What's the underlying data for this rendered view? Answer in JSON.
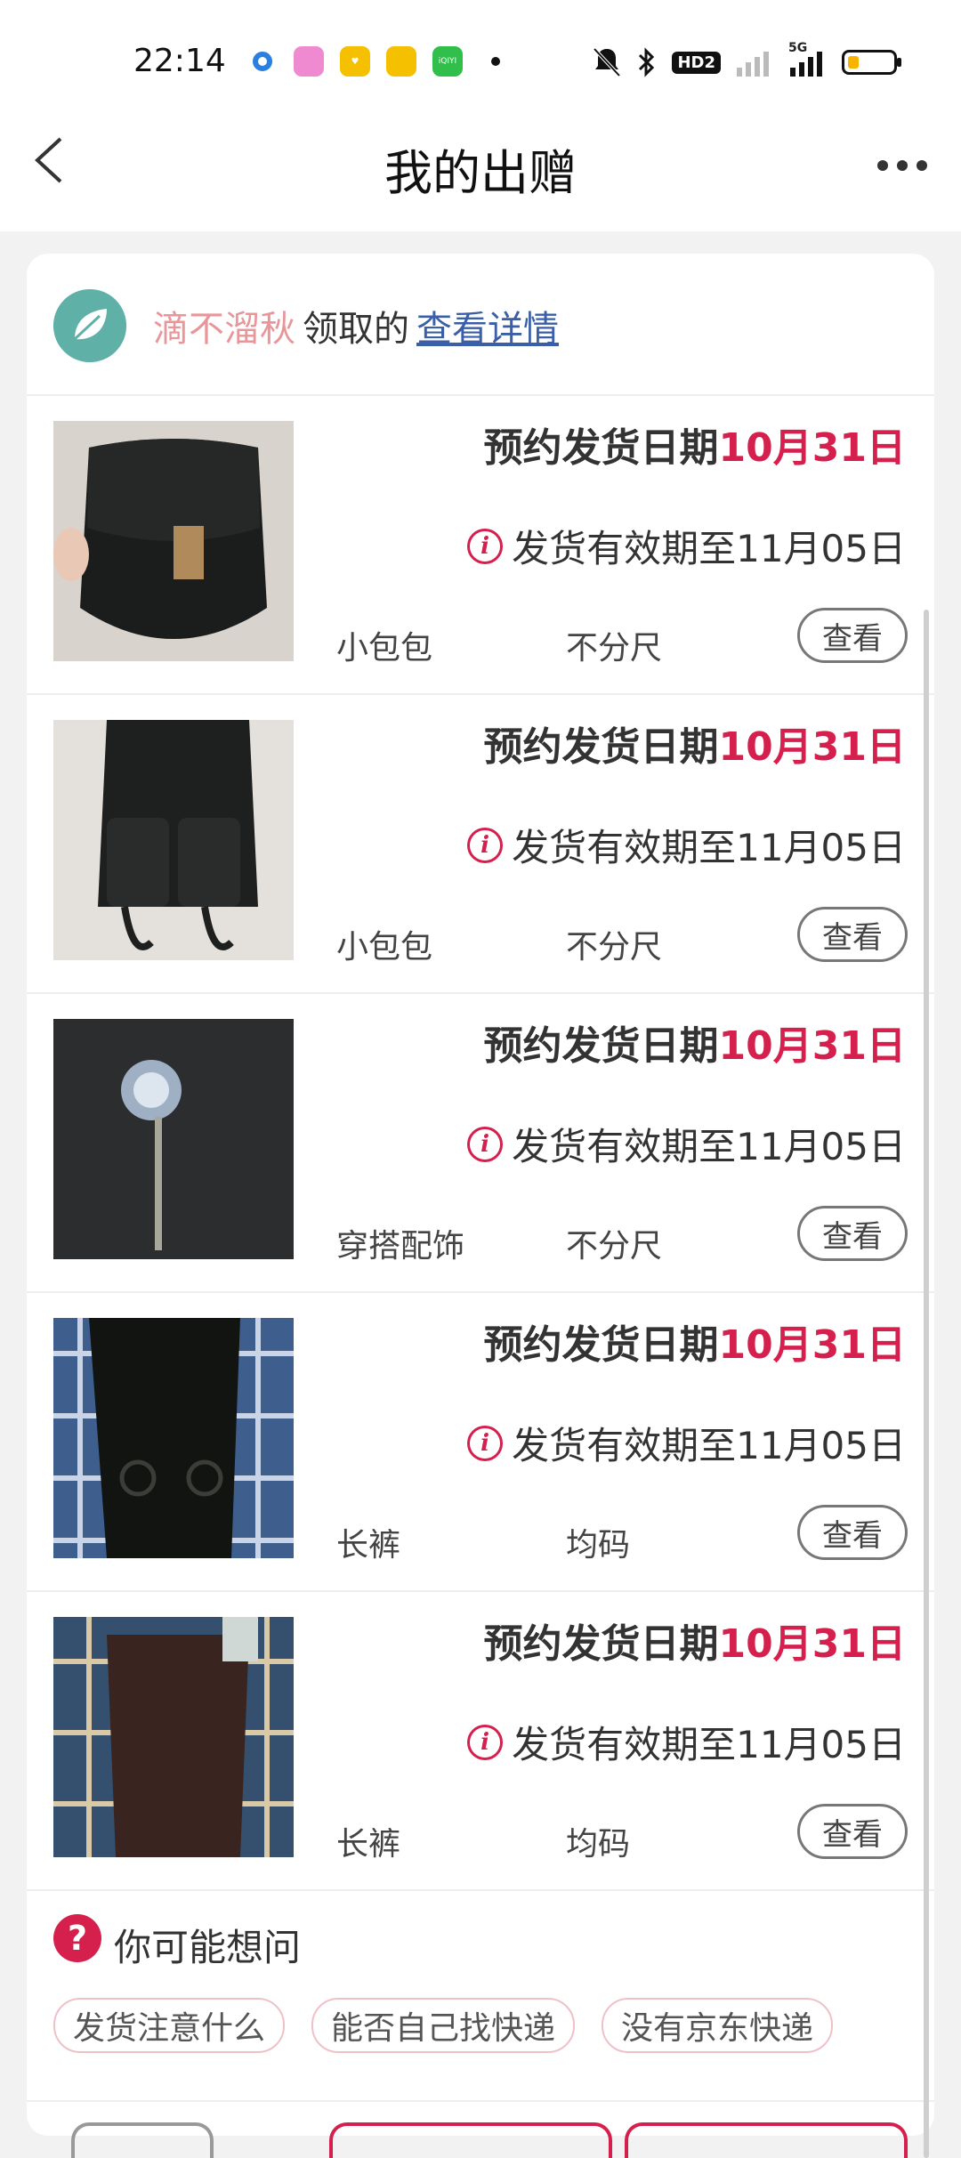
{
  "status_bar": {
    "time": "22:14",
    "icons": [
      "circle-app-icon",
      "camera-app-icon",
      "heart-app-icon",
      "notes-app-icon",
      "iqiyi-app-icon",
      "bell-off-icon",
      "bluetooth-icon",
      "hd-icon",
      "signal-icon",
      "5g-signal-icon",
      "battery-icon"
    ],
    "hd_label": "HD2",
    "net_label": "5G",
    "iqiyi_label": "iQIYI"
  },
  "header": {
    "title": "我的出赠"
  },
  "claim": {
    "name": "滴不溜秋",
    "middle": "领取的",
    "link": "查看详情"
  },
  "items": [
    {
      "ship_prefix": "预约发货日期",
      "ship_date": "10月31日",
      "valid": "发货有效期至11月05日",
      "category": "小包包",
      "size": "不分尺",
      "button": "查看"
    },
    {
      "ship_prefix": "预约发货日期",
      "ship_date": "10月31日",
      "valid": "发货有效期至11月05日",
      "category": "小包包",
      "size": "不分尺",
      "button": "查看"
    },
    {
      "ship_prefix": "预约发货日期",
      "ship_date": "10月31日",
      "valid": "发货有效期至11月05日",
      "category": "穿搭配饰",
      "size": "不分尺",
      "button": "查看"
    },
    {
      "ship_prefix": "预约发货日期",
      "ship_date": "10月31日",
      "valid": "发货有效期至11月05日",
      "category": "长裤",
      "size": "均码",
      "button": "查看"
    },
    {
      "ship_prefix": "预约发货日期",
      "ship_date": "10月31日",
      "valid": "发货有效期至11月05日",
      "category": "长裤",
      "size": "均码",
      "button": "查看"
    }
  ],
  "faq": {
    "title": "你可能想问",
    "chips": [
      "发货注意什么",
      "能否自己找快递",
      "没有京东快递"
    ]
  },
  "colors": {
    "accent": "#d5204e",
    "claim_name": "#e8969a",
    "link": "#3a5ea8"
  }
}
